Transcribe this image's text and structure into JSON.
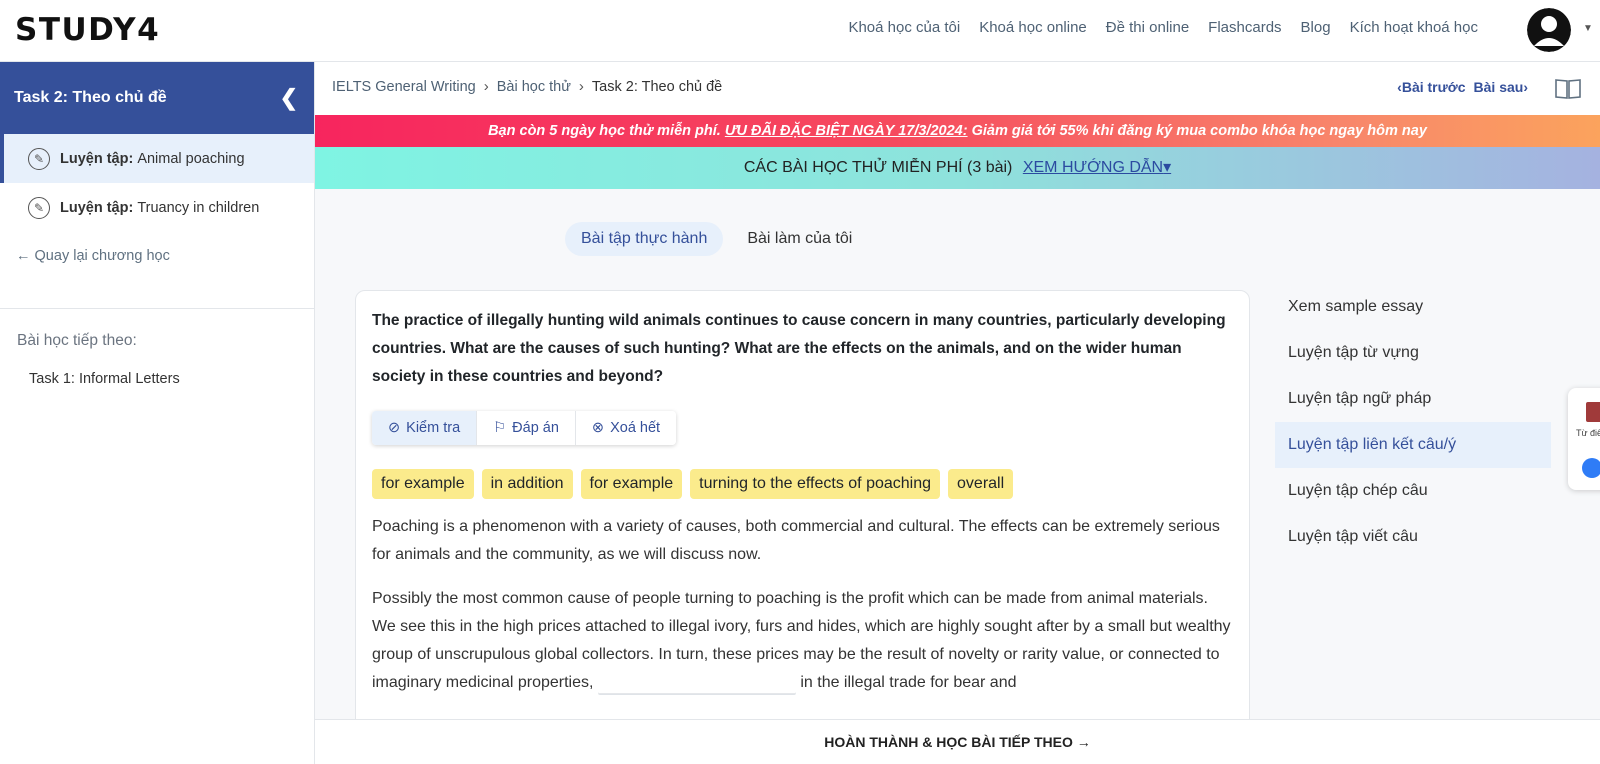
{
  "brand": {
    "logo_text": "STUDY4"
  },
  "nav": {
    "links": [
      "Khoá học của tôi",
      "Khoá học online",
      "Đề thi online",
      "Flashcards",
      "Blog",
      "Kích hoạt khoá học"
    ]
  },
  "sidebar": {
    "header_title": "Task 2: Theo chủ đề",
    "lessons": [
      {
        "prefix": "Luyện tập:",
        "label": "Animal poaching",
        "active": true
      },
      {
        "prefix": "Luyện tập:",
        "label": "Truancy in children",
        "active": false
      }
    ],
    "back_link": "Quay lại chương học",
    "next_label": "Bài học tiếp theo:",
    "next_item": "Task 1: Informal Letters"
  },
  "breadcrumb": {
    "items": [
      "IELTS General Writing",
      "Bài học thử",
      "Task 2: Theo chủ đề"
    ],
    "prev": "Bài trước",
    "next": "Bài sau"
  },
  "promo": {
    "text_before": "Bạn còn 5 ngày học thử miễn phí.",
    "highlight": "ƯU ĐÃI ĐẶC BIỆT NGÀY 17/3/2024:",
    "text_after": "Giảm giá tới 55% khi đăng ký mua combo khóa học ngay hôm nay"
  },
  "free_lessons": {
    "label": "CÁC BÀI HỌC THỬ MIỄN PHÍ (3 bài)",
    "guide_link": "XEM HƯỚNG DẪN"
  },
  "tabs": [
    "Bài tập thực hành",
    "Bài làm của tôi"
  ],
  "exercise": {
    "question": "The practice of illegally hunting wild animals continues to cause concern in many countries, particularly developing countries. What are the causes of such hunting? What are the effects on the animals, and on the wider human society in these countries and beyond?",
    "toolbar": {
      "check": "Kiểm tra",
      "answer": "Đáp án",
      "clear": "Xoá hết"
    },
    "chips": [
      "for example",
      "in addition",
      "for example",
      "turning to the effects of poaching",
      "overall"
    ],
    "paragraph1": "Poaching is a phenomenon with a variety of causes, both commercial and cultural. The effects can be extremely serious for animals and the community, as we will discuss now.",
    "paragraph2_before": "Possibly the most common cause of people turning to poaching is the profit which can be made from animal materials. We see this in the high prices attached to illegal ivory, furs and hides, which are highly sought after by a small but wealthy group of unscrupulous global collectors. In turn, these prices may be the result of novelty or rarity value, or connected to imaginary medicinal properties,",
    "paragraph2_after": "in the illegal trade for bear and"
  },
  "right_menu": {
    "items": [
      "Xem sample essay",
      "Luyện tập từ vựng",
      "Luyện tập ngữ pháp",
      "Luyện tập liên kết câu/ý",
      "Luyện tập chép câu",
      "Luyện tập viết câu"
    ],
    "active_index": 3
  },
  "dict_widget": {
    "label": "Từ điển"
  },
  "bottom": {
    "button": "HOÀN THÀNH & HỌC BÀI TIẾP THEO →"
  },
  "colors": {
    "primary": "#35509a",
    "highlight_chip": "#fbeb8c",
    "active_bg": "#e7f0fb"
  }
}
